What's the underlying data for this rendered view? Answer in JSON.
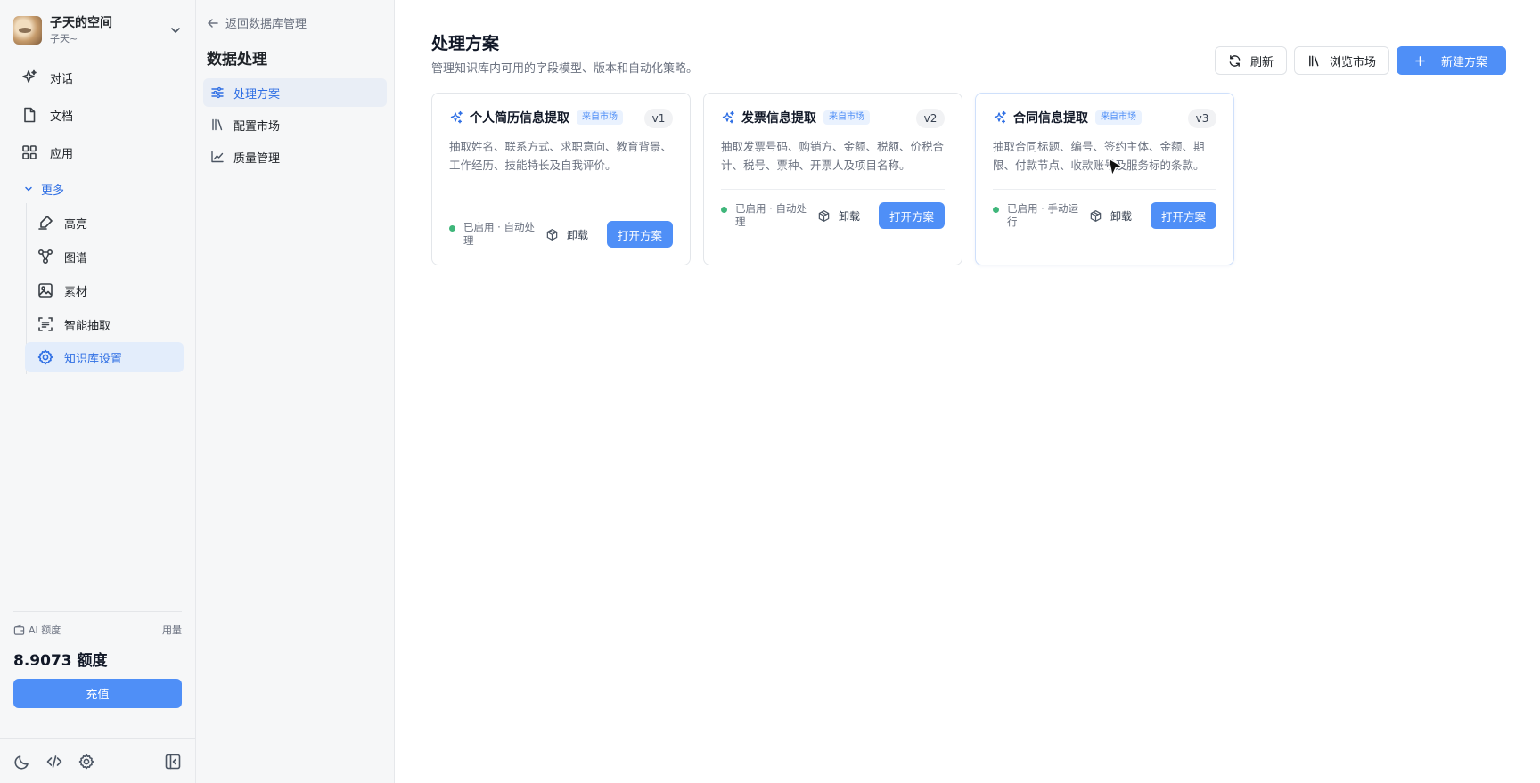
{
  "workspace": {
    "name": "子天的空间",
    "user": "子天~"
  },
  "nav": {
    "items": [
      {
        "label": "对话",
        "icon": "sparkle-chat-icon"
      },
      {
        "label": "文档",
        "icon": "document-icon"
      },
      {
        "label": "应用",
        "icon": "grid-icon"
      }
    ],
    "more_label": "更多",
    "sub_items": [
      {
        "label": "高亮",
        "icon": "highlighter-icon"
      },
      {
        "label": "图谱",
        "icon": "graph-icon"
      },
      {
        "label": "素材",
        "icon": "image-icon"
      },
      {
        "label": "智能抽取",
        "icon": "scan-text-icon"
      },
      {
        "label": "知识库设置",
        "icon": "gear-icon"
      }
    ]
  },
  "quota": {
    "label": "AI 额度",
    "usage_link": "用量",
    "value": "8.9073 额度",
    "recharge_label": "充值"
  },
  "panel2": {
    "back_label": "返回数据库管理",
    "title": "数据处理",
    "items": [
      {
        "label": "处理方案",
        "icon": "sliders-icon"
      },
      {
        "label": "配置市场",
        "icon": "library-icon"
      },
      {
        "label": "质量管理",
        "icon": "chart-line-icon"
      }
    ]
  },
  "main": {
    "title": "处理方案",
    "description": "管理知识库内可用的字段模型、版本和自动化策略。",
    "actions": {
      "refresh": "刷新",
      "browse": "浏览市场",
      "create": "新建方案"
    },
    "cards": [
      {
        "title": "个人简历信息提取",
        "tag": "来自市场",
        "version": "v1",
        "description": "抽取姓名、联系方式、求职意向、教育背景、工作经历、技能特长及自我评价。",
        "status": "已启用 · 自动处理",
        "uninstall": "卸载",
        "open": "打开方案"
      },
      {
        "title": "发票信息提取",
        "tag": "来自市场",
        "version": "v2",
        "description": "抽取发票号码、购销方、金额、税额、价税合计、税号、票种、开票人及项目名称。",
        "status": "已启用 · 自动处理",
        "uninstall": "卸载",
        "open": "打开方案"
      },
      {
        "title": "合同信息提取",
        "tag": "来自市场",
        "version": "v3",
        "description": "抽取合同标题、编号、签约主体、金额、期限、付款节点、收款账号及服务标的条款。",
        "status": "已启用 · 手动运行",
        "uninstall": "卸载",
        "open": "打开方案"
      }
    ]
  },
  "colors": {
    "accent": "#4f8ff7",
    "accent_text": "#2f6fe4",
    "active_bg": "#e3edfb",
    "status_green": "#3fb67a",
    "sidebar_bg": "#f6f7f8"
  }
}
